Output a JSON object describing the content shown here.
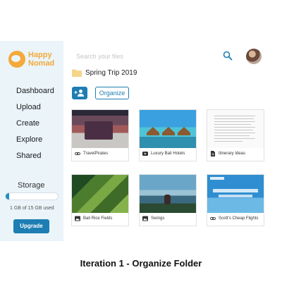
{
  "brand": {
    "name_line1": "Happy",
    "name_line2": "Nomad",
    "color": "#f4a93a"
  },
  "nav": {
    "items": [
      {
        "label": "Dashboard"
      },
      {
        "label": "Upload"
      },
      {
        "label": "Create"
      },
      {
        "label": "Explore"
      },
      {
        "label": "Shared"
      }
    ]
  },
  "storage": {
    "title": "Storage",
    "used_text": "1 GB of 15 GB used",
    "used_fraction": 0.067,
    "upgrade_label": "Upgrade"
  },
  "search": {
    "placeholder": "Search your files"
  },
  "folder": {
    "name": "Spring Trip 2019",
    "organize_label": "Organize"
  },
  "files": [
    {
      "name": "TravelPirates",
      "icon": "link-icon"
    },
    {
      "name": "Luxury Bali Hotels",
      "icon": "video-icon"
    },
    {
      "name": "Itinerary Ideas",
      "icon": "document-icon"
    },
    {
      "name": "Bali Rice Fields",
      "icon": "image-icon"
    },
    {
      "name": "Swings",
      "icon": "image-icon"
    },
    {
      "name": "Scott's Cheap Flights",
      "icon": "link-icon"
    }
  ],
  "caption": "Iteration 1 - Organize Folder",
  "colors": {
    "accent": "#1e7eb3",
    "sidebar_bg": "#eaf4f9"
  }
}
